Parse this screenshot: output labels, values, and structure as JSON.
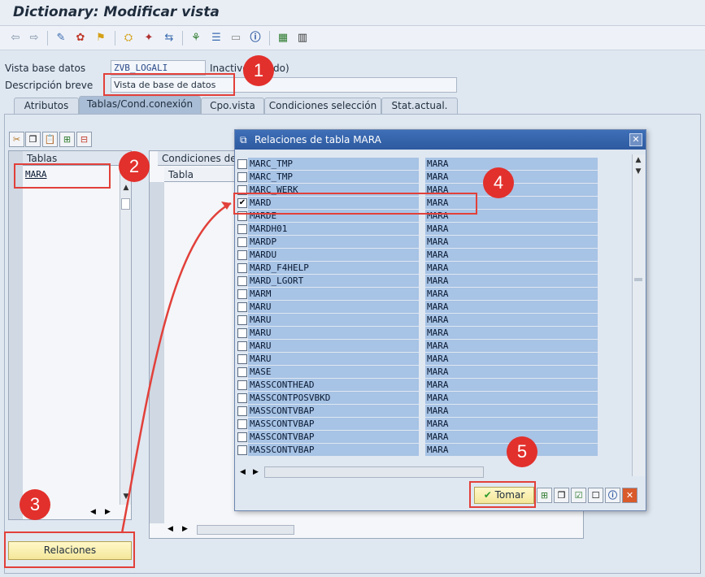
{
  "window": {
    "title": "Dictionary: Modificar vista"
  },
  "fields": {
    "vista_label": "Vista base datos",
    "vista_value": "ZVB_LOGALI",
    "status_text": "Inactivo",
    "status_suffix": "do)",
    "desc_label": "Descripción breve",
    "desc_value": "Vista de base de datos"
  },
  "tabs": [
    {
      "label": "Atributos"
    },
    {
      "label": "Tablas/Cond.conexión"
    },
    {
      "label": "Cpo.vista"
    },
    {
      "label": "Condiciones selección"
    },
    {
      "label": "Stat.actual."
    }
  ],
  "tables_grid": {
    "header": "Tablas",
    "rows": [
      "MARA"
    ]
  },
  "conditions_grid": {
    "header": "Condiciones de",
    "col1": "Tabla"
  },
  "buttons": {
    "relaciones": "Relaciones",
    "tomar": "Tomar"
  },
  "popup": {
    "title": "Relaciones de tabla MARA",
    "rows": [
      {
        "table": "MARC_TMP",
        "ref": "MARA",
        "checked": false
      },
      {
        "table": "MARC_TMP",
        "ref": "MARA",
        "checked": false
      },
      {
        "table": "MARC_WERK",
        "ref": "MARA",
        "checked": false
      },
      {
        "table": "MARD",
        "ref": "MARA",
        "checked": true
      },
      {
        "table": "MARDE",
        "ref": "MARA",
        "checked": false
      },
      {
        "table": "MARDH01",
        "ref": "MARA",
        "checked": false
      },
      {
        "table": "MARDP",
        "ref": "MARA",
        "checked": false
      },
      {
        "table": "MARDU",
        "ref": "MARA",
        "checked": false
      },
      {
        "table": "MARD_F4HELP",
        "ref": "MARA",
        "checked": false
      },
      {
        "table": "MARD_LGORT",
        "ref": "MARA",
        "checked": false
      },
      {
        "table": "MARM",
        "ref": "MARA",
        "checked": false
      },
      {
        "table": "MARU",
        "ref": "MARA",
        "checked": false
      },
      {
        "table": "MARU",
        "ref": "MARA",
        "checked": false
      },
      {
        "table": "MARU",
        "ref": "MARA",
        "checked": false
      },
      {
        "table": "MARU",
        "ref": "MARA",
        "checked": false
      },
      {
        "table": "MARU",
        "ref": "MARA",
        "checked": false
      },
      {
        "table": "MASE",
        "ref": "MARA",
        "checked": false
      },
      {
        "table": "MASSCONTHEAD",
        "ref": "MARA",
        "checked": false
      },
      {
        "table": "MASSCONTPOSVBKD",
        "ref": "MARA",
        "checked": false
      },
      {
        "table": "MASSCONTVBAP",
        "ref": "MARA",
        "checked": false
      },
      {
        "table": "MASSCONTVBAP",
        "ref": "MARA",
        "checked": false
      },
      {
        "table": "MASSCONTVBAP",
        "ref": "MARA",
        "checked": false
      },
      {
        "table": "MASSCONTVBAP",
        "ref": "MARA",
        "checked": false
      }
    ]
  },
  "callouts": [
    "1",
    "2",
    "3",
    "4",
    "5"
  ]
}
